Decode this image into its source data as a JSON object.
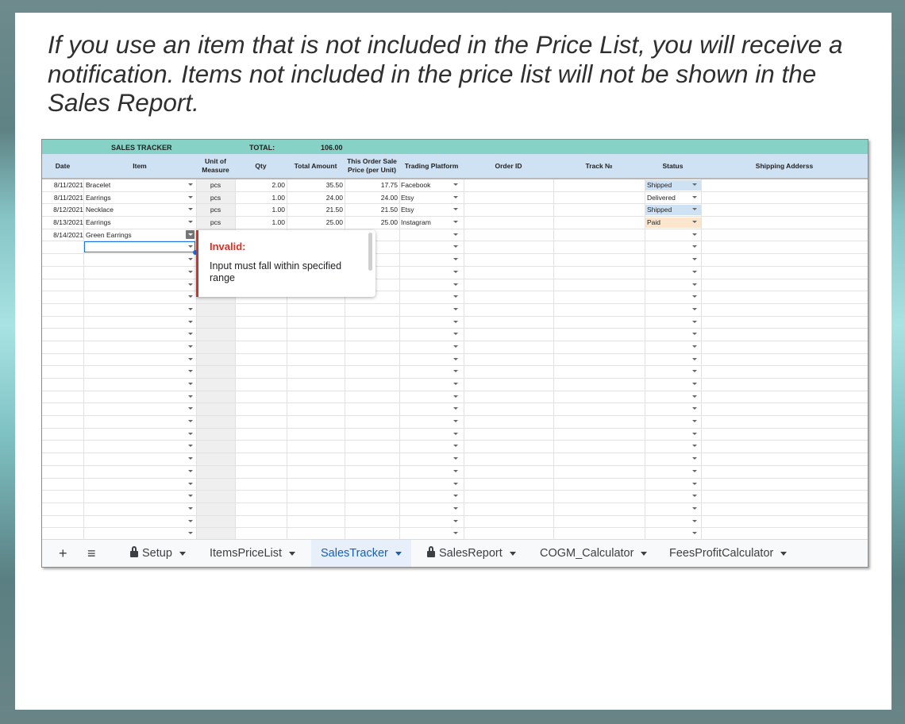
{
  "caption": "If you use an item that is not included in the Price List, you will receive a notification. Items not included in the price list will not be shown in the Sales Report.",
  "sheet": {
    "title": "SALES TRACKER",
    "total_label": "TOTAL:",
    "total_value": "106.00",
    "columns": [
      "Date",
      "Item",
      "Unit of Measure",
      "Qty",
      "Total Amount",
      "This Order Sale Price (per Unit)",
      "Trading Platform",
      "Order ID",
      "Track №",
      "Status",
      "Shipping Adderss"
    ],
    "rows": [
      {
        "date": "8/11/2021",
        "item": "Bracelet",
        "unit": "pcs",
        "qty": "2.00",
        "total": "35.50",
        "price": "17.75",
        "platform": "Facebook",
        "status": "Shipped"
      },
      {
        "date": "8/11/2021",
        "item": "Earrings",
        "unit": "pcs",
        "qty": "1.00",
        "total": "24.00",
        "price": "24.00",
        "platform": "Etsy",
        "status": "Delivered"
      },
      {
        "date": "8/12/2021",
        "item": "Necklace",
        "unit": "pcs",
        "qty": "1.00",
        "total": "21.50",
        "price": "21.50",
        "platform": "Etsy",
        "status": "Shipped"
      },
      {
        "date": "8/13/2021",
        "item": "Earrings",
        "unit": "pcs",
        "qty": "1.00",
        "total": "25.00",
        "price": "25.00",
        "platform": "Instagram",
        "status": "Paid"
      },
      {
        "date": "8/14/2021",
        "item": "Green Earrings",
        "unit": "",
        "qty": "",
        "total": "",
        "price": "",
        "platform": "",
        "status": ""
      }
    ],
    "status_colors": {
      "Shipped": "#cfe2f3",
      "Delivered": "#ffffff",
      "Paid": "#fce5cd"
    }
  },
  "validation_popup": {
    "title": "Invalid:",
    "message": "Input must fall within specified range"
  },
  "tabs": [
    {
      "label": "Setup",
      "locked": true,
      "active": false
    },
    {
      "label": "ItemsPriceList",
      "locked": false,
      "active": false
    },
    {
      "label": "SalesTracker",
      "locked": false,
      "active": true
    },
    {
      "label": "SalesReport",
      "locked": true,
      "active": false
    },
    {
      "label": "COGM_Calculator",
      "locked": false,
      "active": false
    },
    {
      "label": "FeesProfitCalculator",
      "locked": false,
      "active": false
    }
  ],
  "tab_toolbar": {
    "add_glyph": "+",
    "menu_glyph": "≡"
  }
}
